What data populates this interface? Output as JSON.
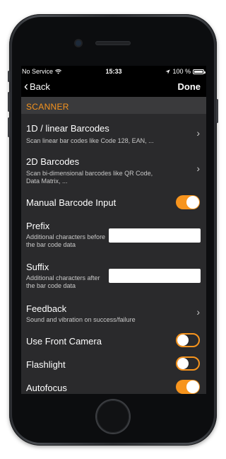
{
  "status": {
    "carrier": "No Service",
    "time": "15:33",
    "battery": "100 %"
  },
  "nav": {
    "back": "Back",
    "done": "Done"
  },
  "section": {
    "title": "SCANNER"
  },
  "rows": {
    "linear": {
      "title": "1D / linear Barcodes",
      "subtitle": "Scan linear bar codes like Code 128, EAN, ..."
    },
    "twod": {
      "title": "2D Barcodes",
      "subtitle": "Scan bi-dimensional barcodes like QR Code, Data Matrix, ..."
    },
    "manual": {
      "title": "Manual Barcode Input",
      "enabled": true
    },
    "prefix": {
      "title": "Prefix",
      "subtitle": "Additional characters before the bar code data",
      "value": ""
    },
    "suffix": {
      "title": "Suffix",
      "subtitle": "Additional characters after the bar code data",
      "value": ""
    },
    "feedback": {
      "title": "Feedback",
      "subtitle": "Sound and vibration on success/failure"
    },
    "front_camera": {
      "title": "Use Front Camera",
      "enabled": false
    },
    "flashlight": {
      "title": "Flashlight",
      "enabled": false
    },
    "autofocus": {
      "title": "Autofocus",
      "enabled": true
    }
  },
  "colors": {
    "accent": "#f7941d",
    "background": "#2a2a2c",
    "header": "#3a3a3c"
  }
}
